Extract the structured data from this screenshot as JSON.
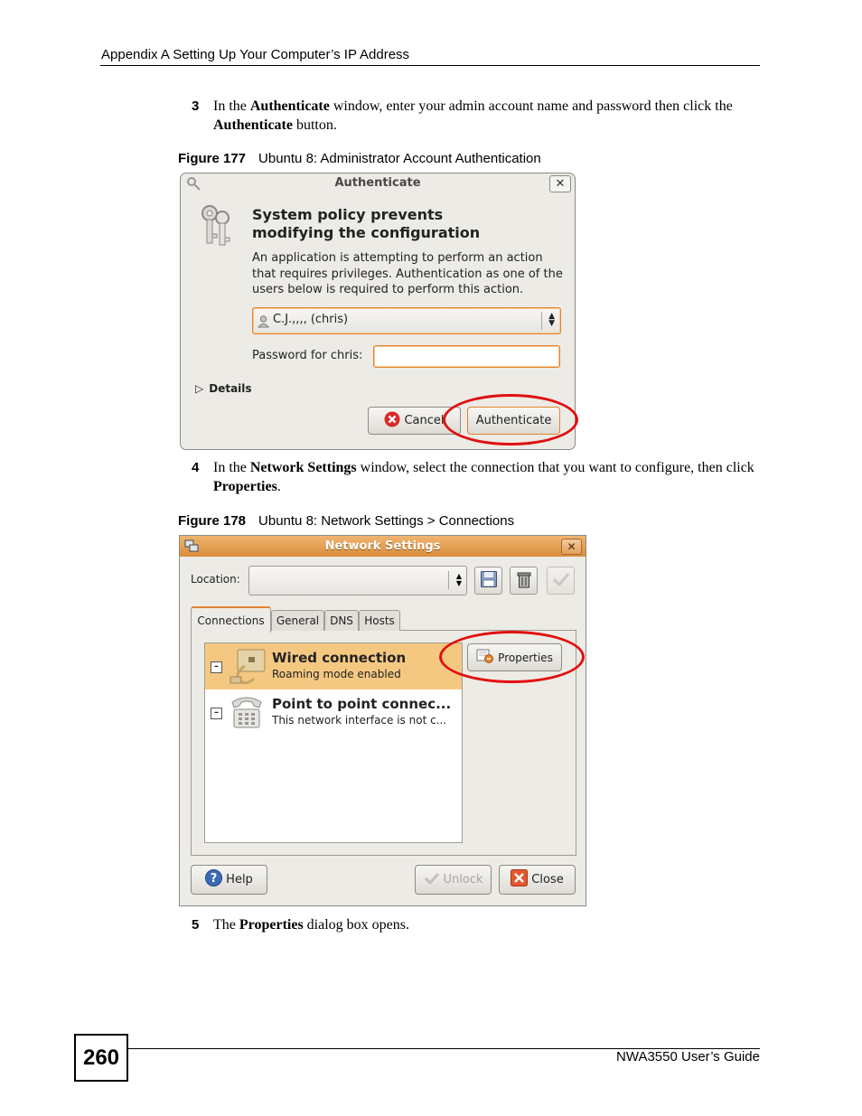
{
  "header": {
    "title": "Appendix A Setting Up Your Computer’s IP Address"
  },
  "footer": {
    "page_number": "260",
    "guide": "NWA3550 User’s Guide"
  },
  "step3": {
    "number": "3",
    "t1": "In the ",
    "b1": "Authenticate",
    "t2": " window, enter your admin account name and password then click the ",
    "b2": "Authenticate",
    "t3": " button."
  },
  "fig177": {
    "label": "Figure 177",
    "title": "Ubuntu 8: Administrator Account Authentication"
  },
  "auth_dialog": {
    "title": "Authenticate",
    "close": "✕",
    "heading_line1": "System policy prevents",
    "heading_line2": "modifying the configuration",
    "body": "An application is attempting to perform an action that requires privileges. Authentication as one of the users below is required to perform this action.",
    "user_value": "C.J.,,,, (chris)",
    "password_label": "Password for chris:",
    "password_value": "",
    "details_label": "Details",
    "cancel_label": "Cancel",
    "authenticate_label": "Authenticate"
  },
  "step4": {
    "number": "4",
    "t1": "In the ",
    "b1": "Network Settings",
    "t2": " window, select the connection that you want to configure, then click ",
    "b2": "Properties",
    "t3": "."
  },
  "fig178": {
    "label": "Figure 178",
    "title": "Ubuntu 8: Network Settings > Connections"
  },
  "net_window": {
    "title": "Network Settings",
    "close": "✕",
    "location_label": "Location:",
    "location_value": "",
    "tabs": [
      {
        "label": "Connections"
      },
      {
        "label": "General"
      },
      {
        "label": "DNS"
      },
      {
        "label": "Hosts"
      }
    ],
    "connections": [
      {
        "title": "Wired connection",
        "subtitle": "Roaming mode enabled",
        "expander": "–"
      },
      {
        "title": "Point to point connec...",
        "subtitle": "This network interface is not c...",
        "expander": "–"
      }
    ],
    "properties_label": "Properties",
    "help_label": "Help",
    "unlock_label": "Unlock",
    "close_label": "Close"
  },
  "step5": {
    "number": "5",
    "t1": "The ",
    "b1": "Properties",
    "t2": " dialog box opens."
  },
  "colors": {
    "accent_orange": "#e4822e",
    "highlight_red": "#e01010",
    "selection": "#f5c882"
  }
}
